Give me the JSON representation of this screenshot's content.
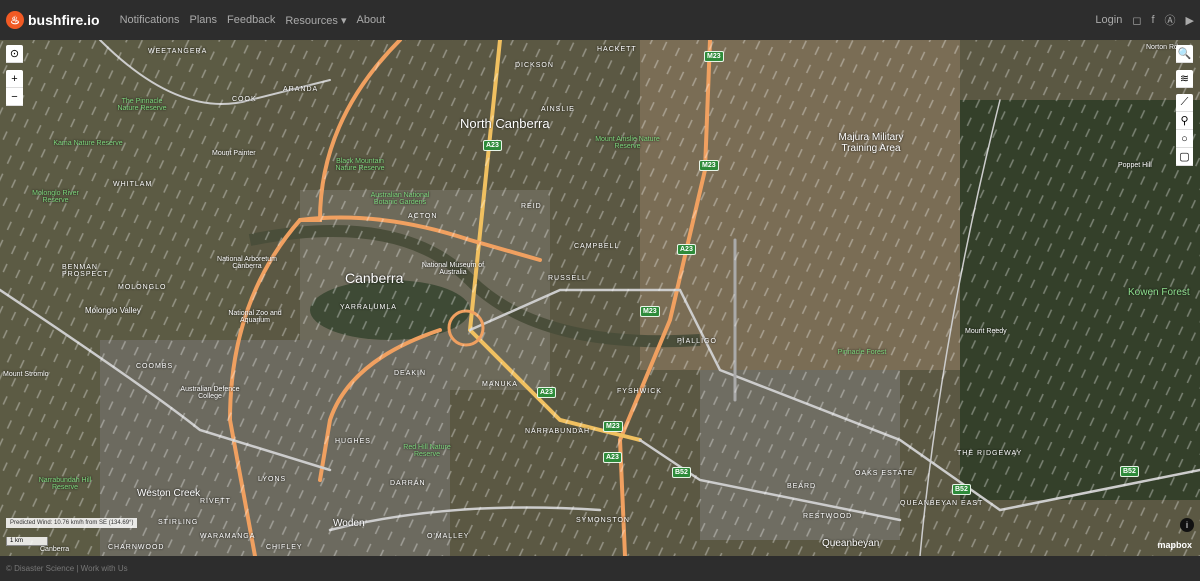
{
  "nav": {
    "brand": "bushfire.io",
    "items": [
      "Notifications",
      "Plans",
      "Feedback",
      "Resources ▾",
      "About"
    ],
    "login": "Login"
  },
  "map": {
    "labels": [
      "North Canberra",
      "Canberra",
      "Majura Military Training Area",
      "Kowen Forest",
      "Weston Creek",
      "Woden",
      "Queanbeyan",
      "WEETANGERA",
      "HACKETT",
      "DICKSON",
      "AINSLIE",
      "COOK",
      "ARANDA",
      "WHITLAM",
      "REID",
      "CAMPBELL",
      "ACTON",
      "RUSSELL",
      "YARRALUMLA",
      "MOLONGLO",
      "RIVETT",
      "STIRLING",
      "WARAMANGA",
      "CHIFLEY",
      "LYONS",
      "HUGHES",
      "DEAKIN",
      "MANUKA",
      "NARRABUNDAH",
      "SYMONSTON",
      "O'MALLEY",
      "PIALLIGO",
      "FYSHWICK",
      "BEARD",
      "OAKS ESTATE",
      "QUEANBEYAN EAST",
      "THE RIDGEWAY",
      "RESTWOOD",
      "CHARNWOOD",
      "Mount Painter",
      "Mount Stromlo",
      "Mount Reedy",
      "Poppet Hill",
      "Molonglo Valley",
      "National Museum of Australia",
      "National Arboretum Canberra",
      "National Zoo and Aquarium",
      "Australian Defence College",
      "DARRAN",
      "COOMBS",
      "BENMAN PROSPECT",
      "Canberra",
      "Norton Rd"
    ],
    "parks": [
      "The Pinnacle Nature Reserve",
      "Kama Nature Reserve",
      "Black Mountain Nature Reserve",
      "Australian National Botanic Gardens",
      "Mount Ainslie Nature Reserve",
      "Molonglo River Reserve",
      "Red Hill Nature Reserve",
      "Narrabundah Hill Reserve",
      "Pinnacle Forest"
    ],
    "road_shields": [
      "A23",
      "M23",
      "M23",
      "A23",
      "M23",
      "A23",
      "M23",
      "A23",
      "B52",
      "B52",
      "B52"
    ],
    "wind": "Predicted Wind: 10.76 km/h from SE (134.69°)",
    "scale": "1 km",
    "attribution": "mapbox"
  },
  "controls": {
    "zoom_in": "+",
    "zoom_out": "−",
    "locate": "⊙",
    "search": "🔍",
    "layers": "≋",
    "line": "⟋",
    "marker": "⚲",
    "circle": "○",
    "rectangle": "▢",
    "info": "i"
  },
  "footer": "© Disaster Science | Work with Us"
}
